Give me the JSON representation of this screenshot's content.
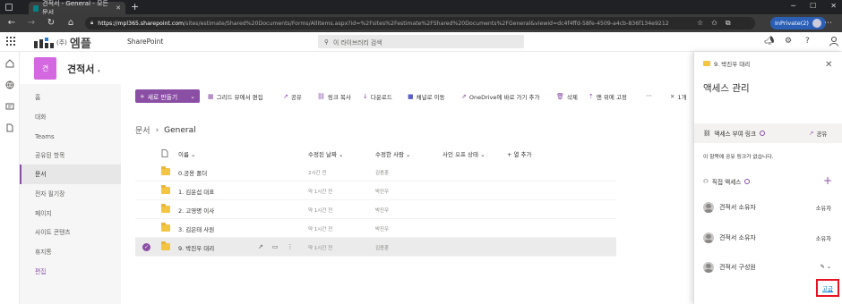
{
  "browser": {
    "tab_title": "견적서 - General - 모든 문서",
    "tab_close": "✕",
    "new_tab": "+",
    "url_host": "https://mpl365.sharepoint.com",
    "url_path": "/sites/estimate/Shared%20Documents/Forms/AllItems.aspx?id=%2Fsites%2Festimate%2FShared%20Documents%2FGeneral&viewid=dc4f4ffd-58fe-4509-a4cb-836f134e9212",
    "inprivate_label": "InPrivate(2)"
  },
  "suite": {
    "logo_text": "엠플",
    "logo_prefix": "(주)",
    "app_name": "SharePoint",
    "search_placeholder": "이 라이브러리 검색"
  },
  "site": {
    "logo_text": "견",
    "title": "견적서"
  },
  "nav": {
    "items": [
      {
        "label": "홈"
      },
      {
        "label": "대화"
      },
      {
        "label": "Teams"
      },
      {
        "label": "공유된 항목"
      },
      {
        "label": "문서"
      },
      {
        "label": "전자 필기장"
      },
      {
        "label": "페이지"
      },
      {
        "label": "사이트 콘텐츠"
      },
      {
        "label": "휴지통"
      },
      {
        "label": "편집"
      }
    ]
  },
  "commands": {
    "new": "새로 만들기",
    "grid_edit": "그리드 뷰에서 편집",
    "share": "공유",
    "copy_link": "링크 복사",
    "download": "다운로드",
    "channel_move": "채널로 이동",
    "onedrive": "OneDrive에 바로 가기 추가",
    "delete": "삭제",
    "pin": "맨 위에 고정",
    "more": "⋯",
    "selected": "1개"
  },
  "breadcrumb": {
    "root": "문서",
    "separator": "›",
    "current": "General"
  },
  "list": {
    "headers": {
      "name": "이름",
      "modified": "수정된 날짜",
      "modified_by": "수정한 사람",
      "signoff": "사인 오프 상태",
      "add_column": "+ 열 추가"
    },
    "rows": [
      {
        "name": "0.공용 폴더",
        "modified": "2시간 전",
        "by": "김종훈"
      },
      {
        "name": "1. 김운섭 대표",
        "modified": "약 1시간 전",
        "by": "박진우"
      },
      {
        "name": "2. 고영명 이사",
        "modified": "약 1시간 전",
        "by": "박진우"
      },
      {
        "name": "3. 김은태 사원",
        "modified": "약 1시간 전",
        "by": "박진우"
      },
      {
        "name": "9. 박진우 대리",
        "modified": "약 1시간 전",
        "by": "김종훈"
      }
    ]
  },
  "panel": {
    "folder_name": "9. 박진우 대리",
    "close": "✕",
    "title": "액세스 관리",
    "links_header": "액세스 부여 링크",
    "share_label": "공유",
    "no_links": "이 항목에 공유 링크가 없습니다.",
    "direct_header": "직접 액세스",
    "add": "+",
    "people": [
      {
        "name": "견적서 소유자",
        "role": "소유자"
      },
      {
        "name": "견적서 소유자",
        "role": "소유자"
      },
      {
        "name": "견적서 구성원",
        "role": "✎ ⌄"
      }
    ],
    "apply": "고급"
  }
}
